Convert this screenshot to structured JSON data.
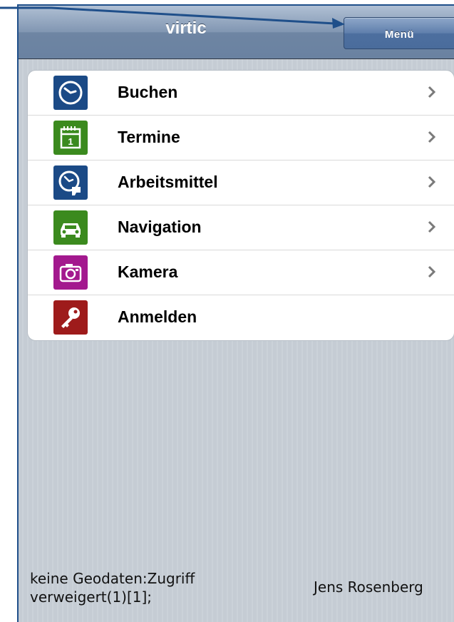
{
  "app": {
    "title": "virtic",
    "menu_label": "Menü"
  },
  "colors": {
    "header": "#7a90ae",
    "clock": "#1b4a86",
    "calendar": "#3b8a1e",
    "tools": "#1b4a86",
    "navigation": "#3b8a1e",
    "camera": "#a3198e",
    "login": "#9e1b1b"
  },
  "menu": {
    "items": [
      {
        "label": "Buchen",
        "icon": "clock-icon",
        "has_chevron": true
      },
      {
        "label": "Termine",
        "icon": "calendar-icon",
        "has_chevron": true
      },
      {
        "label": "Arbeitsmittel",
        "icon": "clock-tool-icon",
        "has_chevron": true
      },
      {
        "label": "Navigation",
        "icon": "car-icon",
        "has_chevron": true
      },
      {
        "label": "Kamera",
        "icon": "camera-icon",
        "has_chevron": true
      },
      {
        "label": "Anmelden",
        "icon": "key-icon",
        "has_chevron": false
      }
    ]
  },
  "calendar_day": "1",
  "footer": {
    "status_line1": "keine Geodaten:Zugriff",
    "status_line2": "verweigert(1)[1];",
    "user": "Jens Rosenberg"
  }
}
